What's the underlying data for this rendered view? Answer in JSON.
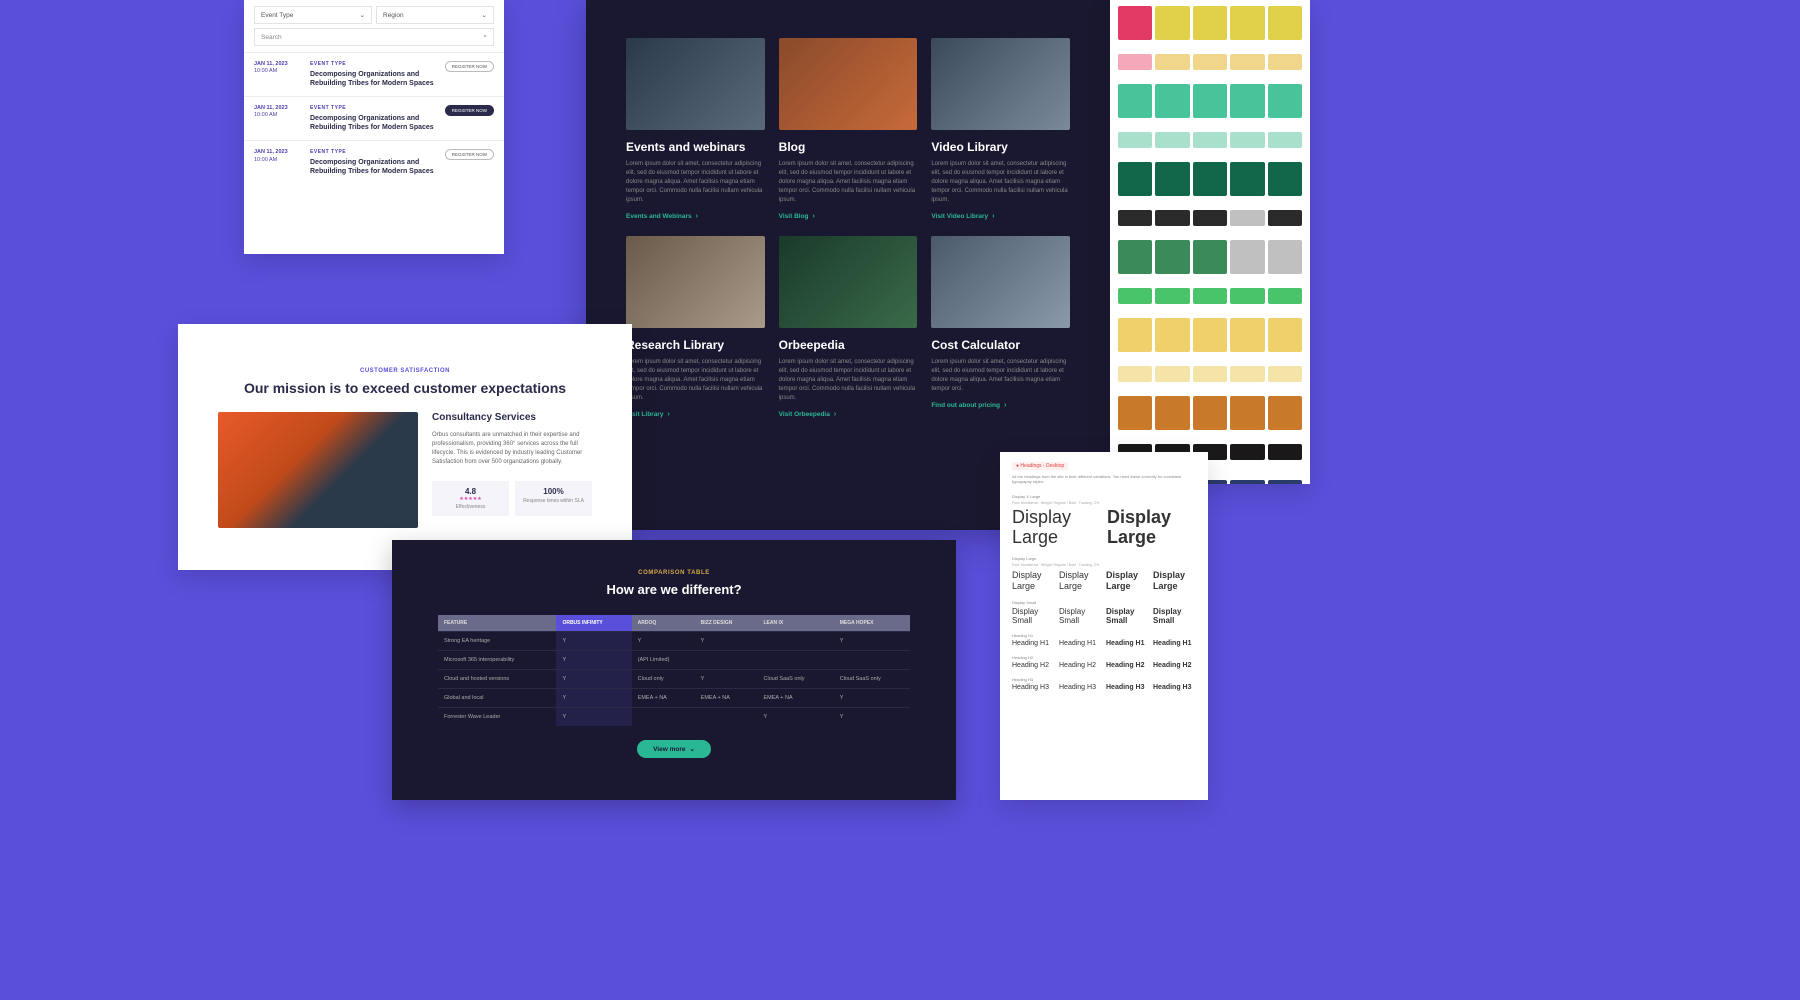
{
  "events": {
    "filter1": "Event Type",
    "filter2": "Region",
    "search": "Search",
    "items": [
      {
        "date1": "JAN 11, 2023",
        "date2": "10:00 AM",
        "type": "EVENT TYPE",
        "title": "Decomposing Organizations and Rebuilding Tribes for Modern Spaces",
        "btn": "REGISTER NOW",
        "dark": false
      },
      {
        "date1": "JAN 11, 2023",
        "date2": "10:00 AM",
        "type": "EVENT TYPE",
        "title": "Decomposing Organizations and Rebuilding Tribes for Modern Spaces",
        "btn": "REGISTER NOW",
        "dark": true
      },
      {
        "date1": "JAN 11, 2023",
        "date2": "10:00 AM",
        "type": "EVENT TYPE",
        "title": "Decomposing Organizations and Rebuilding Tribes for Modern Spaces",
        "btn": "REGISTER NOW",
        "dark": false
      }
    ]
  },
  "resources": {
    "cards": [
      {
        "title": "Events and webinars",
        "desc": "Lorem ipsum dolor sit amet, consectetur adipiscing elit, sed do eiusmod tempor incididunt ut labore et dolore magna aliqua. Amet facilisis magna etiam tempor orci. Commodo nulla facilisi nullam vehicula ipsum.",
        "link": "Events and Webinars"
      },
      {
        "title": "Blog",
        "desc": "Lorem ipsum dolor sit amet, consectetur adipiscing elit, sed do eiusmod tempor incididunt ut labore et dolore magna aliqua. Amet facilisis magna etiam tempor orci. Commodo nulla facilisi nullam vehicula ipsum.",
        "link": "Visit Blog"
      },
      {
        "title": "Video Library",
        "desc": "Lorem ipsum dolor sit amet, consectetur adipiscing elit, sed do eiusmod tempor incididunt ut labore et dolore magna aliqua. Amet facilisis magna etiam tempor orci. Commodo nulla facilisi nullam vehicula ipsum.",
        "link": "Visit Video Library"
      },
      {
        "title": "Research Library",
        "desc": "Lorem ipsum dolor sit amet, consectetur adipiscing elit, sed do eiusmod tempor incididunt ut labore et dolore magna aliqua. Amet facilisis magna etiam tempor orci. Commodo nulla facilisi nullam vehicula ipsum.",
        "link": "Visit Library"
      },
      {
        "title": "Orbeepedia",
        "desc": "Lorem ipsum dolor sit amet, consectetur adipiscing elit, sed do eiusmod tempor incididunt ut labore et dolore magna aliqua. Amet facilisis magna etiam tempor orci. Commodo nulla facilisi nullam vehicula ipsum.",
        "link": "Visit Orbeepedia"
      },
      {
        "title": "Cost Calculator",
        "desc": "Lorem ipsum dolor sit amet, consectetur adipiscing elit, sed do eiusmod tempor incididunt ut labore et dolore magna aliqua. Amet facilisis magna etiam tempor orci.",
        "link": "Find out about pricing"
      }
    ]
  },
  "palette": {
    "rows": [
      [
        "#e23a65",
        "#e0d04a",
        "#e0d04a",
        "#e0d04a",
        "#e0d04a"
      ],
      [
        "#f4a8b8",
        "#f0d68a",
        "#f0d68a",
        "#f0d68a",
        "#f0d68a"
      ],
      [
        "#48c49a",
        "#48c49a",
        "#48c49a",
        "#48c49a",
        "#48c49a"
      ],
      [
        "#a8e0cc",
        "#a8e0cc",
        "#a8e0cc",
        "#a8e0cc",
        "#a8e0cc"
      ],
      [
        "#12664a",
        "#12664a",
        "#12664a",
        "#12664a",
        "#12664a"
      ],
      [
        "#2a2a2a",
        "#2a2a2a",
        "#2a2a2a",
        "#c0c0c0",
        "#2a2a2a"
      ],
      [
        "#3a8a5a",
        "#3a8a5a",
        "#3a8a5a",
        "#c0c0c0",
        "#c0c0c0"
      ],
      [
        "#4ac46a",
        "#4ac46a",
        "#4ac46a",
        "#4ac46a",
        "#4ac46a"
      ],
      [
        "#f0d06a",
        "#f0d06a",
        "#f0d06a",
        "#f0d06a",
        "#f0d06a"
      ],
      [
        "#f4e4a8",
        "#f4e4a8",
        "#f4e4a8",
        "#f4e4a8",
        "#f4e4a8"
      ],
      [
        "#c87a2a",
        "#c87a2a",
        "#c87a2a",
        "#c87a2a",
        "#c87a2a"
      ],
      [
        "#1a1818",
        "#1a1818",
        "#1a1818",
        "#1a1818",
        "#1a1818"
      ]
    ],
    "gradients": [
      [
        "#3a4a8a",
        "#3a4a8a",
        "#2a3a6a",
        "#2a3a6a",
        "#2a3a6a"
      ],
      [
        "#c0a8e8",
        "#c0a8e8",
        "#e0c8f0",
        "#e0c8f0",
        "#e0c8f0"
      ]
    ]
  },
  "mission": {
    "eyebrow": "CUSTOMER SATISFACTION",
    "head": "Our mission is to exceed customer expectations",
    "sub": "Consultancy Services",
    "txt": "Orbus consultants are unmatched in their expertise and professionalism, providing 360° services across the full lifecycle. This is evidenced by industry leading Customer Satisfaction from over 500 organizations globally.",
    "stats": [
      {
        "n": "4.8",
        "stars": "★★★★★",
        "l": "Effectiveness"
      },
      {
        "n": "100%",
        "stars": "",
        "l": "Response times within SLA"
      }
    ]
  },
  "comparison": {
    "eyebrow": "COMPARISON TABLE",
    "head": "How are we different?",
    "headers": [
      "FEATURE",
      "ORBUS INFINITY",
      "ARDOQ",
      "BIZZ DESIGN",
      "LEAN IX",
      "MEGA HOPEX"
    ],
    "rows": [
      [
        "Strong EA heritage",
        "Y",
        "Y",
        "Y",
        "",
        "Y"
      ],
      [
        "Microsoft 365 interoperability",
        "Y",
        "(API Limited)",
        "",
        "",
        ""
      ],
      [
        "Cloud and hosted versions",
        "Y",
        "Cloud only",
        "Y",
        "Cloud SaaS only",
        "Cloud SaaS only"
      ],
      [
        "Global and local",
        "Y",
        "EMEA + NA",
        "EMEA + NA",
        "EMEA + NA",
        "Y"
      ],
      [
        "Forrester Wave Leader",
        "Y",
        "",
        "",
        "Y",
        "Y"
      ]
    ],
    "more": "View more"
  },
  "typo": {
    "tag": "●",
    "head": "Headings - Desktop",
    "sub": "All the headings from the site in their different variations. You need these correctly for consistent typography styles.",
    "displayLargeLabel": "Display X Large",
    "displayLargeMeta": "Font: Montserrat · Weight: Regular / Bold · Tracking -2%",
    "displayLarge": "Display Large",
    "displayLarge4Label": "Display Large",
    "displayLarge4Meta": "Font: Montserrat · Weight: Regular / Bold · Tracking -2%",
    "displaySmallLabel": "Display Small",
    "displaySmall": "Display Small",
    "h1Label": "Heading H1",
    "h1": "Heading H1",
    "h2Label": "Heading H2",
    "h2": "Heading H2",
    "h3Label": "Heading H3",
    "h3": "Heading H3"
  }
}
